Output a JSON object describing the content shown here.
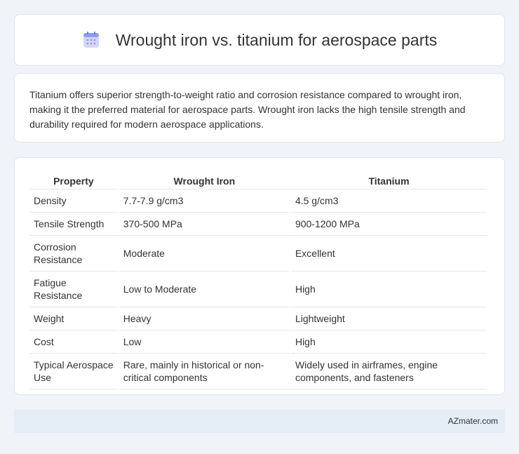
{
  "header": {
    "icon": "calendar-icon",
    "title": "Wrought iron vs. titanium for aerospace parts"
  },
  "summary": {
    "text": "Titanium offers superior strength-to-weight ratio and corrosion resistance compared to wrought iron, making it the preferred material for aerospace parts. Wrought iron lacks the high tensile strength and durability required for modern aerospace applications."
  },
  "table": {
    "headers": [
      "Property",
      "Wrought Iron",
      "Titanium"
    ],
    "rows": [
      [
        "Density",
        "7.7-7.9 g/cm3",
        "4.5 g/cm3"
      ],
      [
        "Tensile Strength",
        "370-500 MPa",
        "900-1200 MPa"
      ],
      [
        "Corrosion Resistance",
        "Moderate",
        "Excellent"
      ],
      [
        "Fatigue Resistance",
        "Low to Moderate",
        "High"
      ],
      [
        "Weight",
        "Heavy",
        "Lightweight"
      ],
      [
        "Cost",
        "Low",
        "High"
      ],
      [
        "Typical Aerospace Use",
        "Rare, mainly in historical or non-critical components",
        "Widely used in airframes, engine components, and fasteners"
      ]
    ]
  },
  "footer": {
    "text": "AZmater.com"
  },
  "colors": {
    "background": "#f0f3f8",
    "footer_bg": "#e5edf7",
    "icon_accent": "#7b6cf6"
  }
}
